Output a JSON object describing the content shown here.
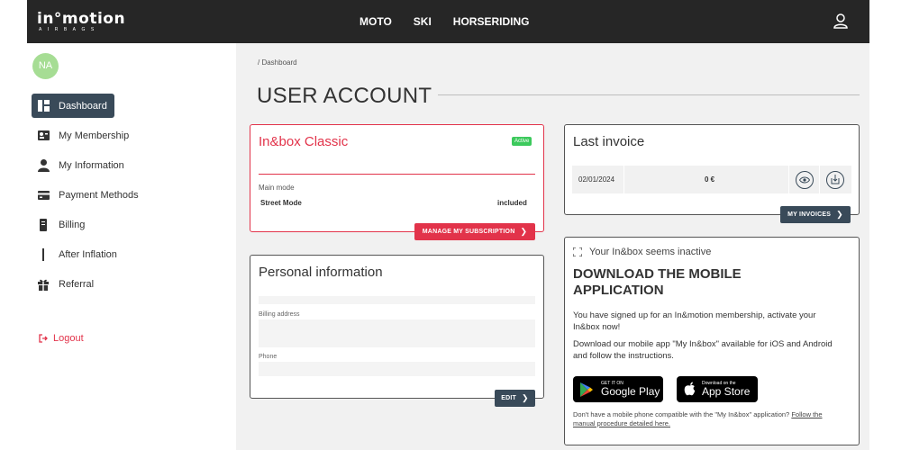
{
  "topbar": {
    "logo_main": "in°motion",
    "logo_sub": "AIRBAGS",
    "nav": [
      "MOTO",
      "SKI",
      "HORSERIDING"
    ]
  },
  "sidebar": {
    "avatar_initials": "NA",
    "items": [
      {
        "label": "Dashboard",
        "icon": "dashboard-icon"
      },
      {
        "label": "My Membership",
        "icon": "membership-card-icon"
      },
      {
        "label": "My Information",
        "icon": "person-icon"
      },
      {
        "label": "Payment Methods",
        "icon": "credit-card-icon"
      },
      {
        "label": "Billing",
        "icon": "billing-icon"
      },
      {
        "label": "After Inflation",
        "icon": "after-inflation-icon"
      },
      {
        "label": "Referral",
        "icon": "gift-icon"
      }
    ],
    "logout": "Logout"
  },
  "main": {
    "breadcrumb": "/ Dashboard",
    "title": "USER ACCOUNT"
  },
  "subscription": {
    "title": "In&box Classic",
    "status": "Active",
    "mode_label": "Main mode",
    "mode_value": "Street Mode",
    "mode_included": "included",
    "button": "MANAGE MY SUBSCRIPTION"
  },
  "personal": {
    "title": "Personal information",
    "billing_label": "Billing address",
    "phone_label": "Phone",
    "button": "EDIT"
  },
  "invoice": {
    "title": "Last invoice",
    "date": "02/01/2024",
    "amount": "0 €",
    "button": "MY INVOICES"
  },
  "app": {
    "inactive": "Your In&box seems inactive",
    "heading": "DOWNLOAD THE MOBILE APPLICATION",
    "text1": "You have signed up for an In&motion membership, activate your In&box now!",
    "text2": "Download our mobile app \"My In&box\" available for iOS and Android and follow the instructions.",
    "google_small": "GET IT ON",
    "google_big": "Google Play",
    "apple_small": "Download on the",
    "apple_big": "App Store",
    "foot_text": "Don't have a mobile phone compatible with the \"My In&box\" application?",
    "foot_link": "Follow the manual procedure detailed here."
  },
  "colors": {
    "topbar": "#262626",
    "accent_red": "#e2334a",
    "dark_button": "#394a59",
    "active_badge": "#3cc95c",
    "avatar": "#a6dd94"
  }
}
